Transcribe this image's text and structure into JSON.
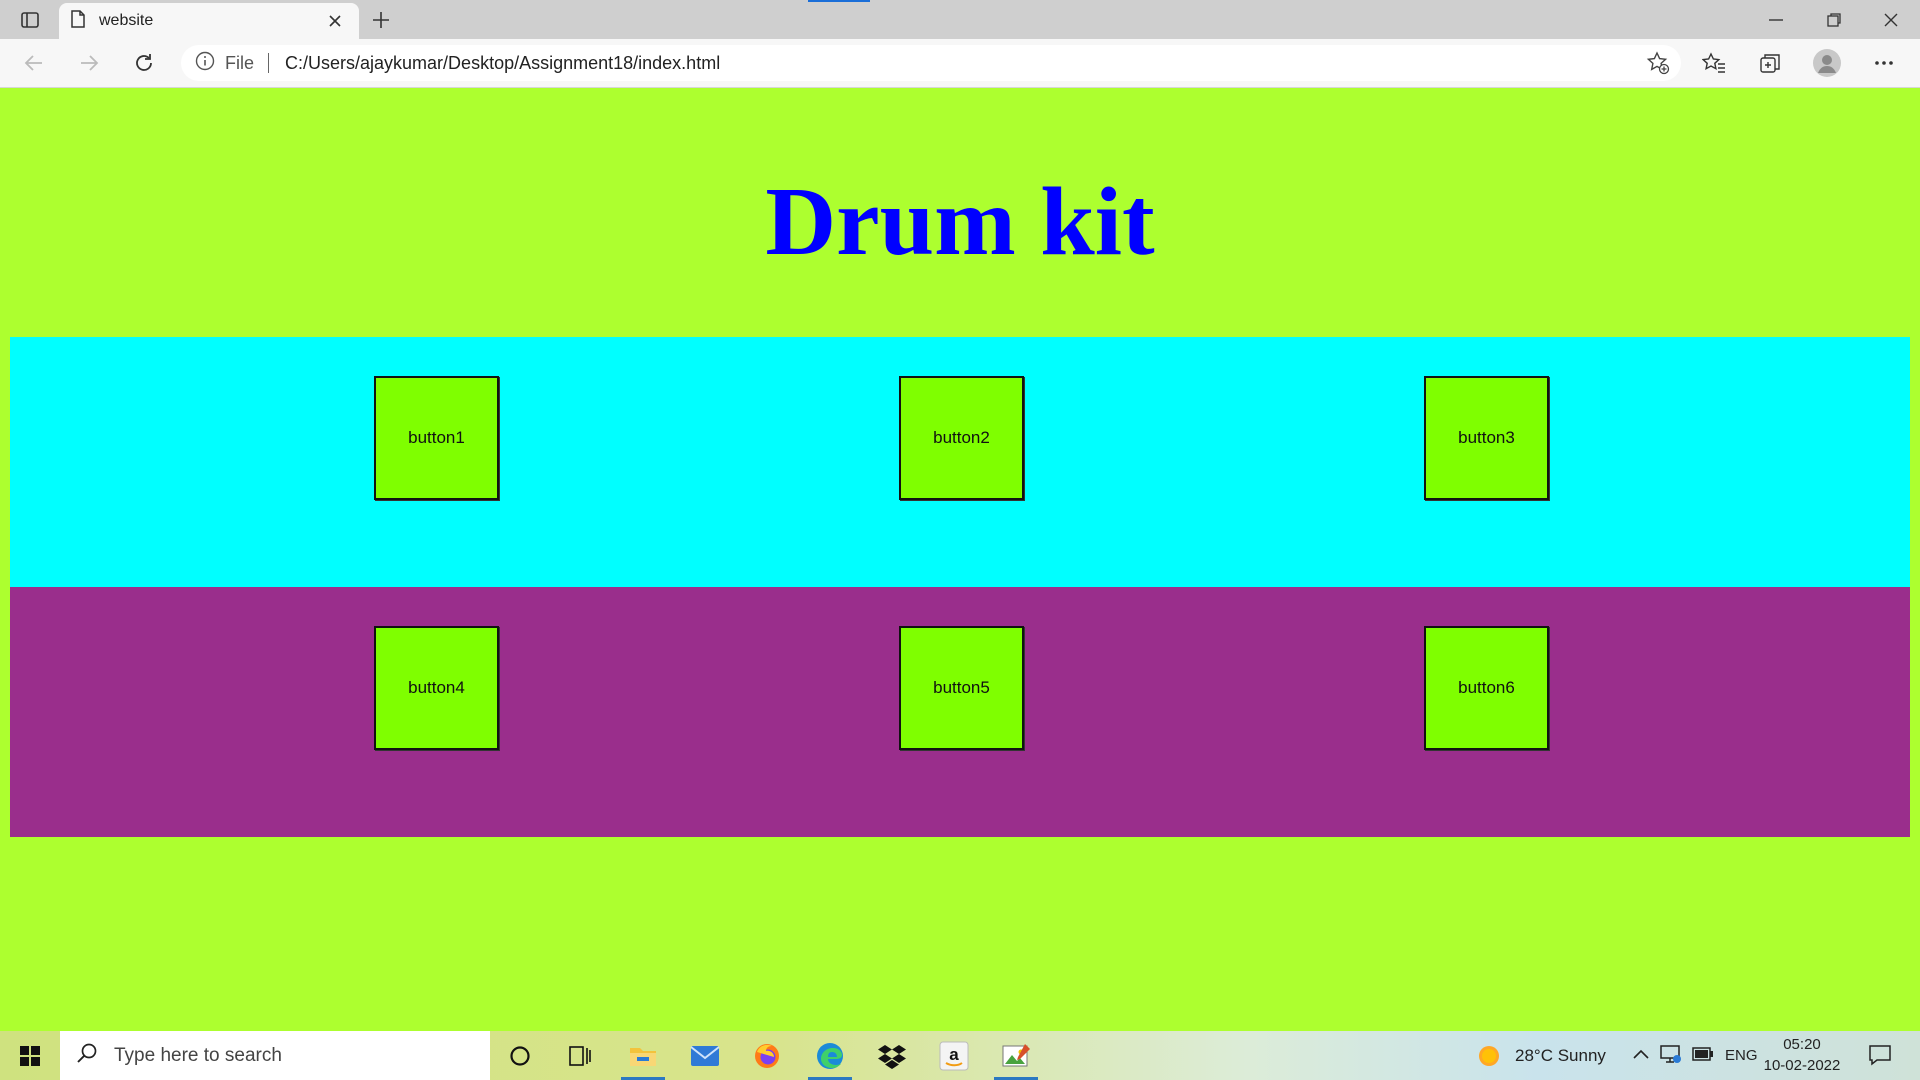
{
  "browser": {
    "tab_title": "website",
    "address_scheme": "File",
    "url": "C:/Users/ajaykumar/Desktop/Assignment18/index.html"
  },
  "page": {
    "title": "Drum kit",
    "rows": [
      {
        "color": "#00ffff",
        "buttons": [
          "button1",
          "button2",
          "button3"
        ]
      },
      {
        "color": "#9a2e8c",
        "buttons": [
          "button4",
          "button5",
          "button6"
        ]
      }
    ],
    "background_color": "#adff2f",
    "title_color": "#0000ff",
    "button_color": "#7fff00"
  },
  "taskbar": {
    "search_placeholder": "Type here to search",
    "weather": "28°C  Sunny",
    "language": "ENG",
    "time": "05:20",
    "date": "10-02-2022",
    "pinned_apps": [
      "cortana-icon",
      "task-view-icon",
      "file-explorer-icon",
      "mail-icon",
      "firefox-icon",
      "edge-icon",
      "dropbox-icon",
      "amazon-icon",
      "paint-icon"
    ]
  }
}
